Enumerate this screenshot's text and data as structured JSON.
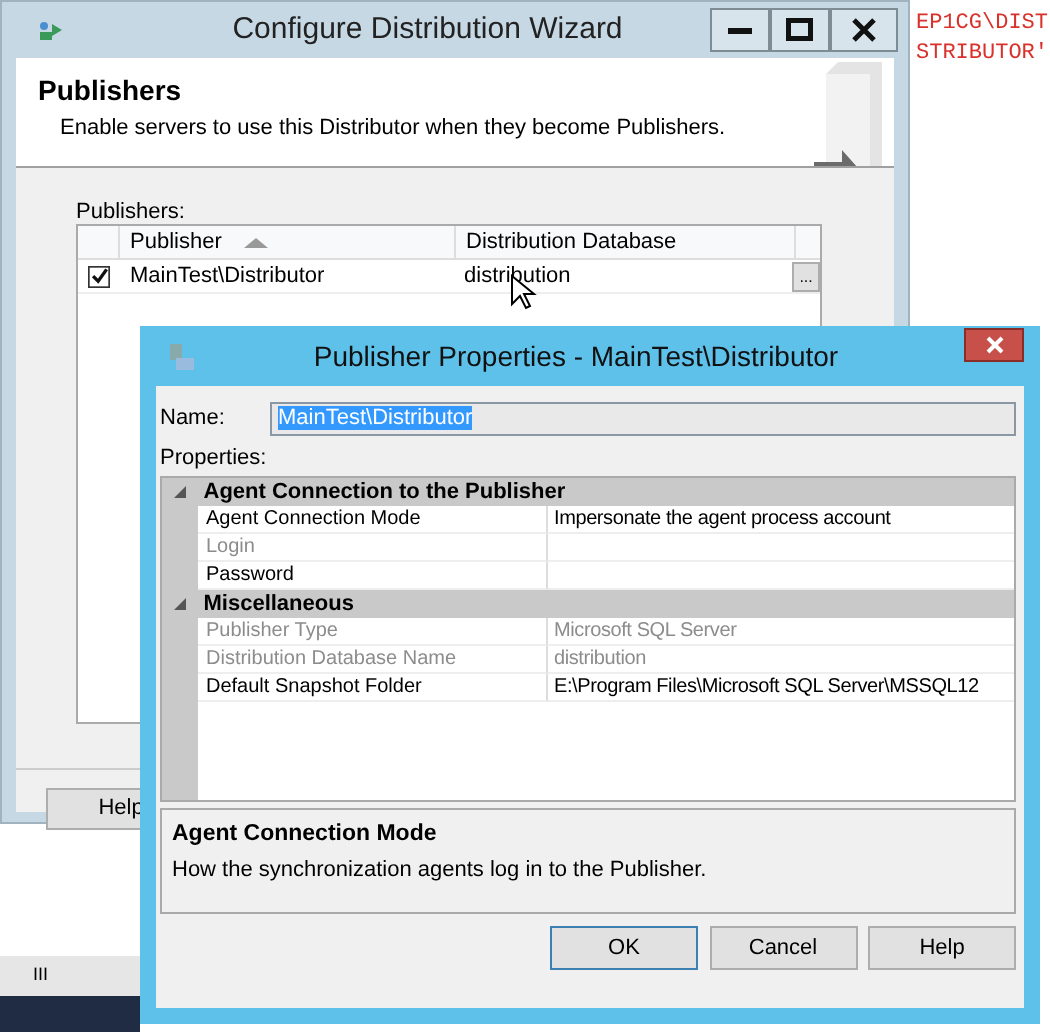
{
  "background_code": [
    "EP1CG\\DIST",
    "STRIBUTOR'"
  ],
  "wizard": {
    "title": "Configure Distribution Wizard",
    "header": {
      "title": "Publishers",
      "subtitle": "Enable servers to use this Distributor when they become Publishers."
    },
    "list_label": "Publishers:",
    "columns": [
      {
        "label": "Publisher",
        "sorted": true
      },
      {
        "label": "Distribution Database",
        "sorted": false
      }
    ],
    "rows": [
      {
        "checked": true,
        "publisher": "MainTest\\Distributor",
        "database": "distribution",
        "button": "..."
      }
    ],
    "help_button": "Help"
  },
  "scrollbar": {
    "grip": "III"
  },
  "dialog": {
    "title": "Publisher Properties - MainTest\\Distributor",
    "name_label": "Name:",
    "name_value": "MainTest\\Distributor",
    "name_selected": true,
    "properties_label": "Properties:",
    "categories": [
      {
        "name": "Agent Connection to the Publisher",
        "expanded": true,
        "properties": [
          {
            "name": "Agent Connection Mode",
            "value": "Impersonate the agent process account",
            "disabled": false
          },
          {
            "name": "Login",
            "disabled": true
          },
          {
            "name": "Password",
            "disabled": false
          }
        ]
      },
      {
        "name": "Miscellaneous",
        "expanded": true,
        "properties": [
          {
            "name": "Publisher Type",
            "value": "Microsoft SQL Server",
            "disabled": true
          },
          {
            "name": "Distribution Database Name",
            "value": "distribution",
            "disabled": true
          },
          {
            "name": "Default Snapshot Folder",
            "value": "E:\\Program Files\\Microsoft SQL Server\\MSSQL12",
            "disabled": false
          }
        ]
      }
    ],
    "description": {
      "title": "Agent Connection Mode",
      "text": "How the synchronization agents log in to the Publisher."
    },
    "buttons": [
      {
        "label": "OK",
        "default": true
      },
      {
        "label": "Cancel",
        "default": false
      },
      {
        "label": "Help",
        "default": false
      }
    ]
  }
}
